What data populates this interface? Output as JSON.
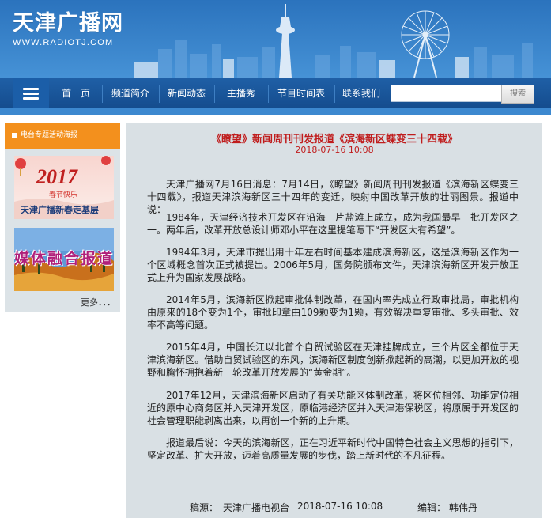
{
  "site": {
    "logo_title": "天津广播网",
    "logo_sub": "WWW.RADIOTJ.COM",
    "brand_color": "#3a86cc",
    "nav_color": "#144c8d"
  },
  "nav": {
    "items": [
      "首　页",
      "频道简介",
      "新闻动态",
      "主播秀",
      "节目时间表",
      "联系我们"
    ],
    "search_placeholder": "",
    "search_label": "搜索"
  },
  "sidebar": {
    "title": "电台专题活动海报",
    "title_color": "#f3901d",
    "promo1": {
      "year": "2017",
      "greeting": "春节快乐",
      "caption": "天津广播新春走基层"
    },
    "promo2": {
      "caption": "媒体融合报道"
    },
    "more": "更多．．．"
  },
  "article": {
    "title": "《瞭望》新闻周刊刊发报道《滨海新区蝶变三十四载》",
    "date": "2018-07-16 10:08",
    "title_color": "#c01d1d",
    "paragraphs": [
      "天津广播网7月16日消息：7月14日，《瞭望》新闻周刊刊发报道《滨海新区蝶变三十四载》，报道天津滨海新区三十四年的变迁，映射中国改革开放的壮丽图景。报道中说：",
      "1984年，天津经济技术开发区在沿海一片盐滩上成立，成为我国最早一批开发区之一。两年后，改革开放总设计师邓小平在这里提笔写下“开发区大有希望”。",
      "1994年3月，天津市提出用十年左右时间基本建成滨海新区，这是滨海新区作为一个区域概念首次正式被提出。2006年5月，国务院颁布文件，天津滨海新区开发开放正式上升为国家发展战略。",
      "2014年5月，滨海新区掀起审批体制改革，在国内率先成立行政审批局，审批机构由原来的18个变为1个，审批印章由109颗变为1颗，有效解决重复审批、多头审批、效率不高等问题。",
      "2015年4月，中国长江以北首个自贸试验区在天津挂牌成立，三个片区全都位于天津滨海新区。借助自贸试验区的东风，滨海新区制度创新掀起新的高潮，以更加开放的视野和胸怀拥抱着新一轮改革开放发展的“黄金期”。",
      "2017年12月，天津滨海新区启动了有关功能区体制改革，将区位相邻、功能定位相近的原中心商务区并入天津开发区，原临港经济区并入天津港保税区，将原属于开发区的社会管理职能剥离出来，以再创一个新的上升期。",
      "报道最后说：今天的滨海新区，正在习近平新时代中国特色社会主义思想的指引下，坚定改革、扩大开放，迈着高质量发展的步伐，踏上新时代的不凡征程。"
    ],
    "source_label": "稿源：",
    "source": "天津广播电视台",
    "source_date": "2018-07-16 10:08",
    "editor_label": "编辑：",
    "editor": "韩伟丹"
  }
}
